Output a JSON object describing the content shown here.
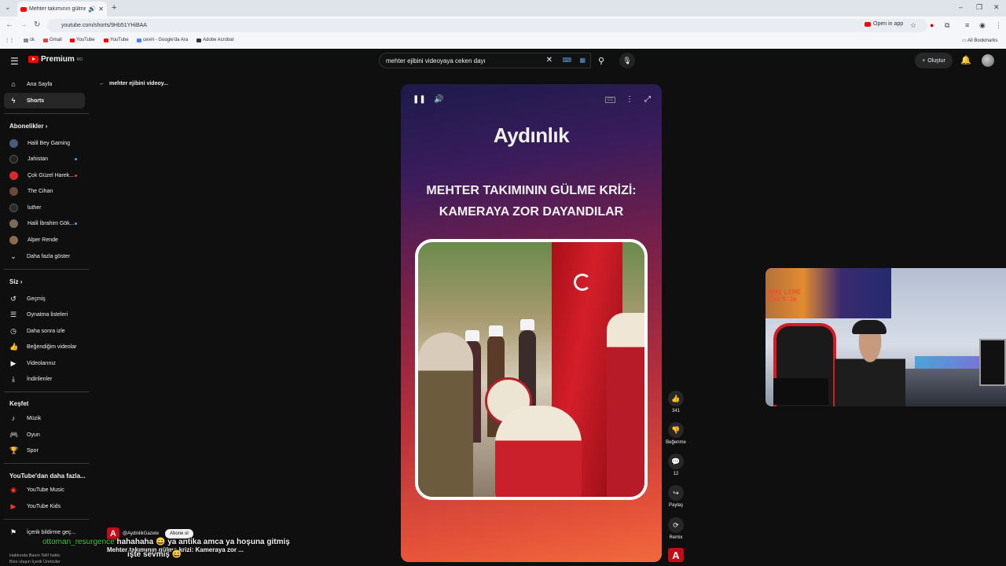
{
  "browser": {
    "tab_title": "Mehter takımının gülme kri:",
    "url": "youtube.com/shorts/9Hb51YHiBAA",
    "open_in_app": "Open in app",
    "bookmarks": [
      "ck",
      "Gmail",
      "YouTube",
      "YouTube",
      "ceviri - Google'da Ara",
      "Adobe Acrobat"
    ],
    "all_bookmarks": "All Bookmarks"
  },
  "header": {
    "logo_text": "Premium",
    "logo_sup": "RO",
    "search_value": "mehter ejibini videoyaya ceken dayı",
    "create_label": "Oluştur"
  },
  "sidebar": {
    "home": "Ana Sayfa",
    "shorts": "Shorts",
    "subscriptions_title": "Abonelikler",
    "subscriptions": [
      {
        "label": "Halil Bey Gaming",
        "color": "#4a5a7a"
      },
      {
        "label": "Jahistan",
        "color": "#222222"
      },
      {
        "label": "Çok Güzel Harek...",
        "color": "#d92a2a"
      },
      {
        "label": "The Cihan",
        "color": "#6b4a3a"
      },
      {
        "label": "luther",
        "color": "#2a2a2a"
      },
      {
        "label": "Halil İbrahim Gök...",
        "color": "#7a6a5a"
      },
      {
        "label": "Alper Rende",
        "color": "#8a6a4a"
      }
    ],
    "show_more": "Daha fazla göster",
    "you_title": "Siz",
    "you_items": [
      "Geçmiş",
      "Oynatma listeleri",
      "Daha sonra izle",
      "Beğendiğim videolar",
      "Videolarınız",
      "İndirilenler"
    ],
    "explore_title": "Keşfet",
    "explore_items": [
      "Müzik",
      "Oyun",
      "Spor"
    ],
    "more_title": "YouTube'dan daha fazla...",
    "more_items": [
      "YouTube Music",
      "YouTube Kids"
    ],
    "report": "İçerik bildirme geç...",
    "footer_1": "Hakkında  Basın  Telif hakkı",
    "footer_2": "Bize ulaşın  İçerik Üreticiler"
  },
  "back_label": "mehter ejibini videoy...",
  "short": {
    "brand": "Aydınlık",
    "headline_1": "MEHTER TAKIMININ GÜLME KRİZİ:",
    "headline_2": "KAMERAYA ZOR DAYANDILAR",
    "likes": "341",
    "dislike": "Beğenme",
    "comments": "12",
    "share": "Paylaş",
    "remix": "Remix",
    "channel": "@AydinlikGazete",
    "subscribe": "Abone ol",
    "title": "Mehter takımının gülme krizi: Kameraya zor ..."
  },
  "chat": {
    "user": "ottoman_resurgence",
    "message_1": "hahahaha",
    "message_2": "ya antika amca ya hoşuna gitmiş",
    "message_3": "işte sevmiş"
  },
  "webcam": {
    "poster_text_1": "WIN' LEHE",
    "poster_text_2": "Zed ft. Ja"
  }
}
